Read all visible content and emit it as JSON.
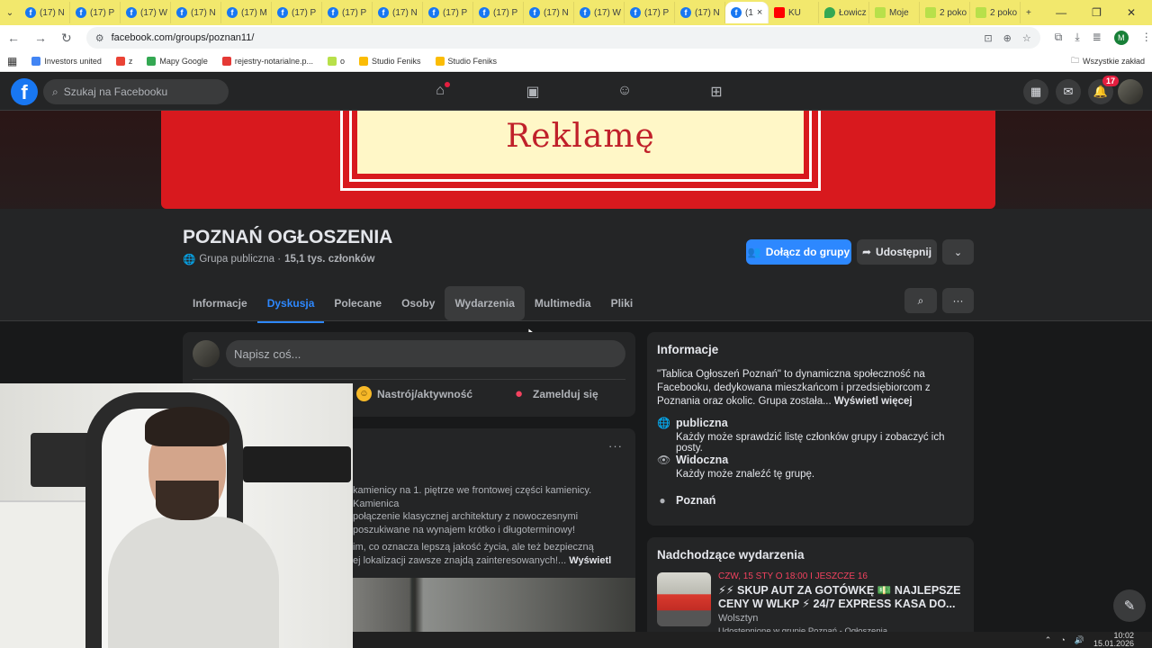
{
  "browser": {
    "tabs": [
      {
        "label": "(17) N",
        "icon": "facebook-icon"
      },
      {
        "label": "(17) P",
        "icon": "facebook-icon"
      },
      {
        "label": "(17) W",
        "icon": "facebook-icon"
      },
      {
        "label": "(17) N",
        "icon": "facebook-icon"
      },
      {
        "label": "(17) M",
        "icon": "facebook-icon"
      },
      {
        "label": "(17) P",
        "icon": "facebook-icon"
      },
      {
        "label": "(17) P",
        "icon": "facebook-icon"
      },
      {
        "label": "(17) N",
        "icon": "facebook-icon"
      },
      {
        "label": "(17) P",
        "icon": "facebook-icon"
      },
      {
        "label": "(17) P",
        "icon": "facebook-icon"
      },
      {
        "label": "(17) N",
        "icon": "facebook-icon"
      },
      {
        "label": "(17) W",
        "icon": "facebook-icon"
      },
      {
        "label": "(17) P",
        "icon": "facebook-icon"
      },
      {
        "label": "(17) N",
        "icon": "facebook-icon"
      }
    ],
    "active_tab": {
      "label": "(1",
      "close": "×"
    },
    "extra_tabs": [
      {
        "label": "KU",
        "icon": "youtube-icon"
      },
      {
        "label": "Łowicz",
        "icon": "maps-icon"
      },
      {
        "label": "Moje",
        "icon": "sheet-icon"
      },
      {
        "label": "2 poko",
        "icon": "sheet-icon"
      },
      {
        "label": "2 poko",
        "icon": "sheet-icon"
      }
    ],
    "new_tab": "+",
    "url": "facebook.com/groups/poznan11/",
    "bookmarks": [
      {
        "label": "Investors united"
      },
      {
        "label": "z"
      },
      {
        "label": "Mapy Google"
      },
      {
        "label": "rejestry-notarialne.p..."
      },
      {
        "label": "o"
      },
      {
        "label": "Studio Feniks"
      },
      {
        "label": "Studio Feniks"
      }
    ],
    "bookmarks_all": "Wszystkie zakład"
  },
  "facebook": {
    "search_placeholder": "Szukaj na Facebooku",
    "notifications_count": "17",
    "cover_text": "Reklamę",
    "group_name": "POZNAŃ OGŁOSZENIA",
    "group_meta_type": "Grupa publiczna · ",
    "group_meta_members": "15,1 tys. członków",
    "join_button": "Dołącz do grupy",
    "share_button": "Udostępnij",
    "tabs": [
      "Informacje",
      "Dyskusja",
      "Polecane",
      "Osoby",
      "Wydarzenia",
      "Multimedia",
      "Pliki"
    ],
    "composer_placeholder": "Napisz coś...",
    "composer_actions": {
      "feeling": "Nastrój/aktywność",
      "checkin": "Zamelduj się"
    },
    "post_text": [
      "kamienicy na 1. piętrze we frontowej części kamienicy. Kamienica",
      "połączenie klasycznej architektury z nowoczesnymi",
      "poszukiwane na wynajem krótko i długoterminowy!",
      "im, co oznacza lepszą jakość życia, ale też bezpieczną",
      "ej lokalizacji zawsze znajdą zainteresowanych!..."
    ],
    "post_see_more": "Wyświetl",
    "info": {
      "title": "Informacje",
      "description": "\"Tablica Ogłoszeń Poznań\" to dynamiczna społeczność na Facebooku, dedykowana mieszkańcom i przedsiębiorcom z Poznania oraz okolic. Grupa została...",
      "see_more": "Wyświetl więcej",
      "public_title": "publiczna",
      "public_desc": "Każdy może sprawdzić listę członków grupy i zobaczyć ich posty.",
      "visible_title": "Widoczna",
      "visible_desc": "Każdy może znaleźć tę grupę.",
      "location": "Poznań"
    },
    "events": {
      "title": "Nadchodzące wydarzenia",
      "date": "CZW, 15 STY O 18:00 I JESZCZE 16",
      "name": "⚡⚡ SKUP AUT ZA GOTÓWKĘ 💵 NAJLEPSZE CENY W WLKP ⚡ 24/7 EXPRESS KASA DO...",
      "location": "Wolsztyn",
      "shared": "Udostępnione w grupie Poznań - Ogłoszenia"
    }
  },
  "taskbar": {
    "time": "10:02",
    "date": "15.01.2026"
  }
}
